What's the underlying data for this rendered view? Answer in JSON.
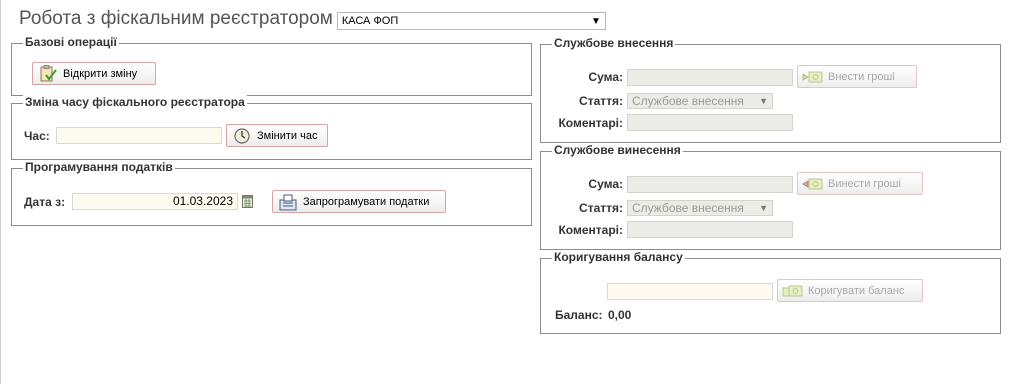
{
  "header": {
    "title": "Робота з фіскальним реєстратором",
    "register_select": "КАСА ФОП"
  },
  "basic_ops": {
    "legend": "Базові операції",
    "open_shift_label": "Відкрити зміну"
  },
  "change_time": {
    "legend": "Зміна часу фіскального реєстратора",
    "time_label": "Час:",
    "time_value": "",
    "change_button_label": "Змінити час"
  },
  "tax_programming": {
    "legend": "Програмування податків",
    "date_label": "Дата з:",
    "date_value": "01.03.2023",
    "program_button_label": "Запрограмувати податки"
  },
  "service_deposit": {
    "legend": "Службове внесення",
    "sum_label": "Сума:",
    "article_label": "Стаття:",
    "article_value": "Службове внесення",
    "comment_label": "Коментарі:",
    "button_label": "Внести гроші"
  },
  "service_withdrawal": {
    "legend": "Службове винесення",
    "sum_label": "Сума:",
    "article_label": "Стаття:",
    "article_value": "Службове внесення",
    "comment_label": "Коментарі:",
    "button_label": "Винести гроші"
  },
  "balance_correction": {
    "legend": "Коригування балансу",
    "button_label": "Коригувати баланс",
    "balance_label": "Баланс:",
    "balance_value": "0,00"
  }
}
